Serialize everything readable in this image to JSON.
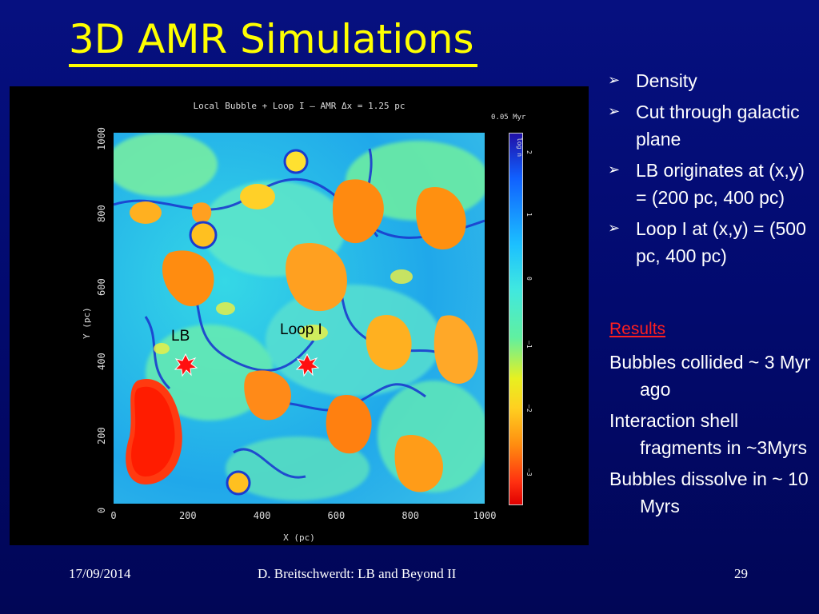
{
  "slide": {
    "title": "3D AMR Simulations",
    "bullets": [
      "Density",
      "Cut through galactic plane",
      "LB originates at (x,y) = (200 pc, 400 pc)",
      "Loop I at (x,y) = (500 pc, 400 pc)"
    ],
    "bullet_marker": "➢",
    "results_heading": "Results",
    "results": [
      "Bubbles collided ~ 3 Myr ago",
      "Interaction shell fragments in ~3Myrs",
      "Bubbles dissolve in ~ 10 Myrs"
    ],
    "footer": {
      "date": "17/09/2014",
      "author": "D. Breitschwerdt: LB and Beyond II",
      "page": "29"
    },
    "colors": {
      "title": "#ffff00",
      "results_heading": "#ff1f1f",
      "background": "#020a6e"
    }
  },
  "figure": {
    "title": "Local Bubble + Loop I – AMR Δx = 1.25 pc",
    "time_label": "0.05 Myr",
    "colorbar_label": "log n",
    "colorbar_ticks": [
      "2",
      "1",
      "0",
      "–1",
      "–2",
      "–3"
    ],
    "x_label": "X (pc)",
    "y_label": "Y (pc)",
    "x_ticks": [
      "0",
      "200",
      "400",
      "600",
      "800",
      "1000"
    ],
    "y_ticks": [
      "0",
      "200",
      "400",
      "600",
      "800",
      "1000"
    ],
    "annotations": {
      "lb": "LB",
      "loop": "Loop I"
    }
  }
}
